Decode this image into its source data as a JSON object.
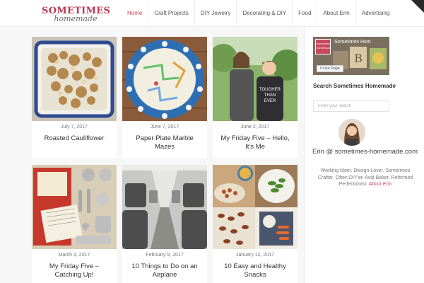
{
  "site": {
    "logo_line1": "SOMETIMES",
    "logo_line2": "homemade"
  },
  "nav": {
    "items": [
      "Home",
      "Craft Projects",
      "DIY Jewelry",
      "Decorating & DIY",
      "Food",
      "About Erin",
      "Advertising"
    ],
    "active": "Home"
  },
  "posts": [
    {
      "date": "July 7, 2017",
      "title": "Roasted Cauliflower"
    },
    {
      "date": "June 7, 2017",
      "title": "Paper Plate Marble Mazes"
    },
    {
      "date": "June 2, 2017",
      "title": "My Friday Five – Hello, It’s Me"
    },
    {
      "date": "March 3, 2017",
      "title": "My Friday Five – Catching Up!"
    },
    {
      "date": "February 9, 2017",
      "title": "10 Things to Do on an Airplane"
    },
    {
      "date": "January 12, 2017",
      "title": "10 Easy and Healthy Snacks"
    }
  ],
  "sidebar": {
    "fb_page_name": "Sometimes Hom",
    "fb_logo_text": "sometimes homemade",
    "fb_like_label": "Like Page",
    "search_heading": "Search Sometimes Homemade",
    "search_placeholder": "Enter your search",
    "about_name": "Erin @ sometimes-homemade.com",
    "about_bio": "Working Mom. Design Lover. Sometimes Crafter. Often DIY'er. Avid Baker. Reformed Perfectionist.",
    "about_link": "About Erin"
  },
  "colors": {
    "accent": "#c8485f",
    "background": "#f7f7f7",
    "corner": "#2a2a2a"
  }
}
